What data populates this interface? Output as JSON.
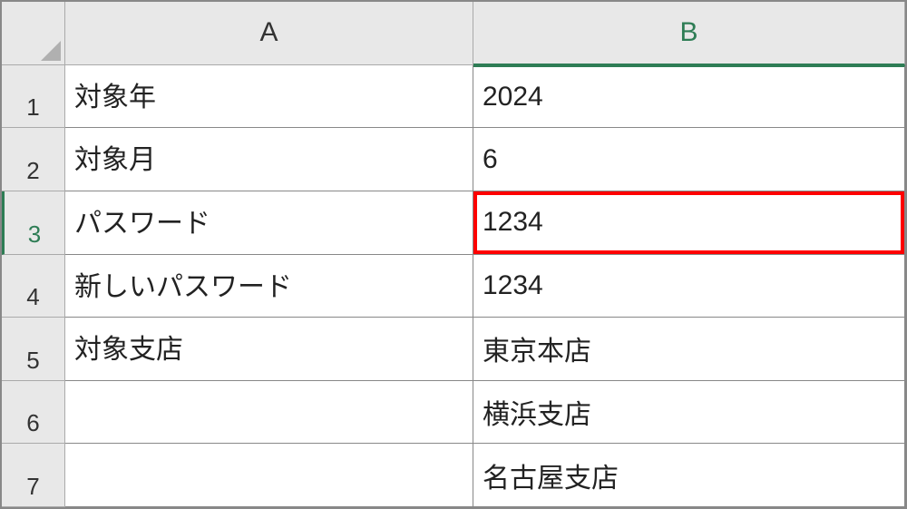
{
  "columns": {
    "a": "A",
    "b": "B"
  },
  "rowNumbers": [
    "1",
    "2",
    "3",
    "4",
    "5",
    "6",
    "7"
  ],
  "cells": {
    "a1": "対象年",
    "b1": "2024",
    "a2": "対象月",
    "b2": "6",
    "a3": "パスワード",
    "b3": "1234",
    "a4": "新しいパスワード",
    "b4": "1234",
    "a5": "対象支店",
    "b5": "東京本店",
    "a6": "",
    "b6": "横浜支店",
    "a7": "",
    "b7": "名古屋支店"
  },
  "selectedRow": "3",
  "selectedColumn": "B"
}
